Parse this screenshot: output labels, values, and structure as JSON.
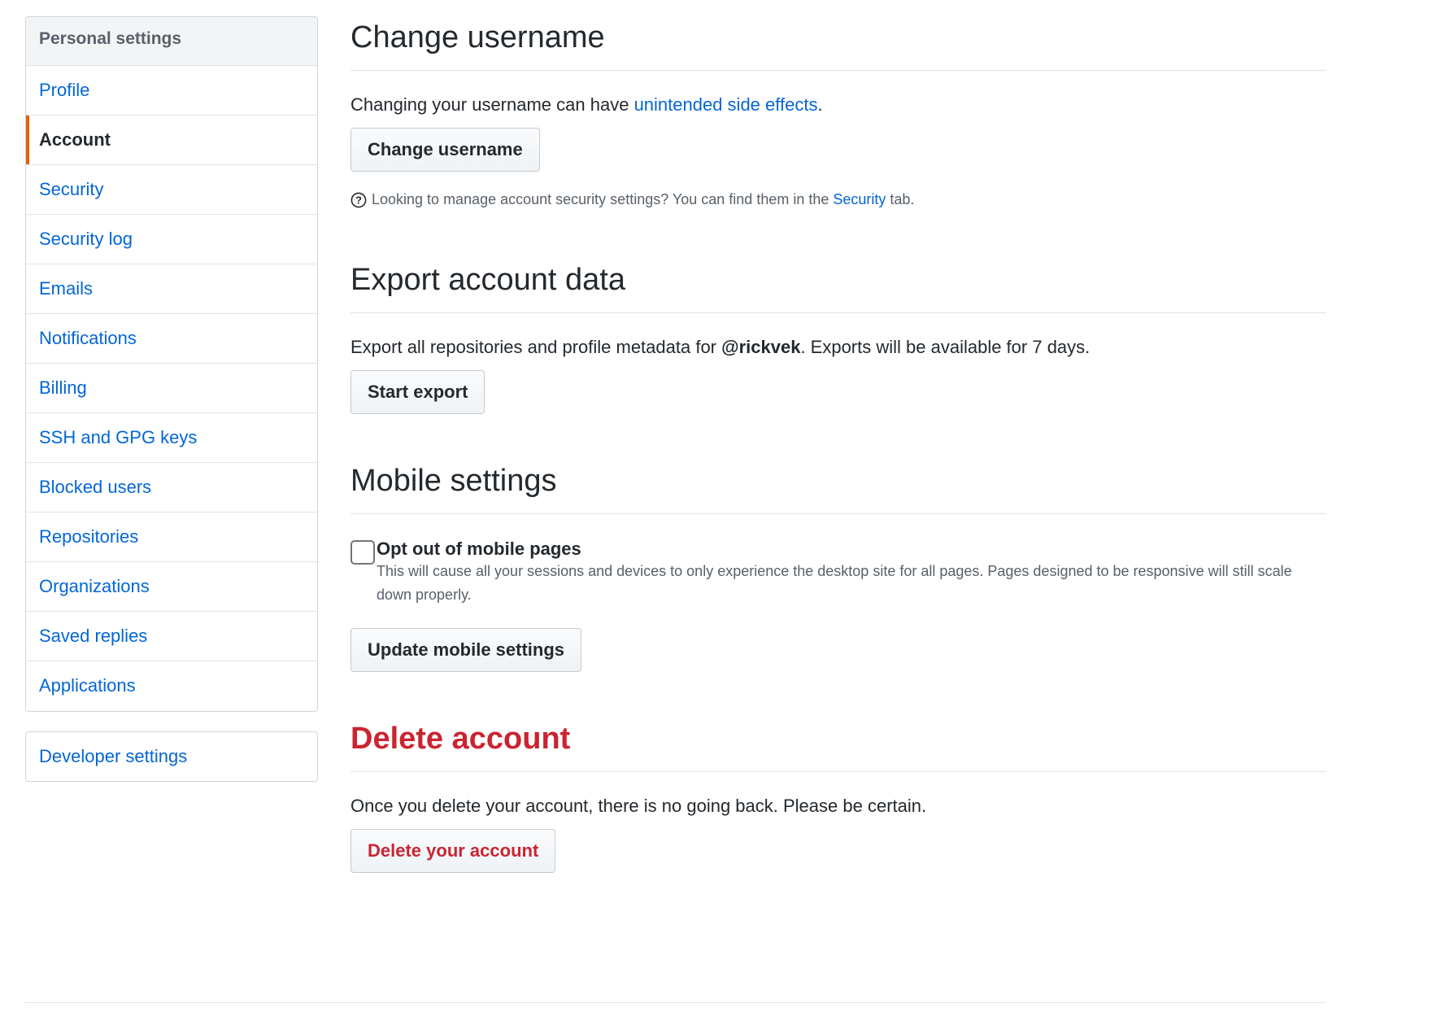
{
  "sidebar": {
    "heading": "Personal settings",
    "items": [
      {
        "label": "Profile"
      },
      {
        "label": "Account",
        "selected": true
      },
      {
        "label": "Security"
      },
      {
        "label": "Security log"
      },
      {
        "label": "Emails"
      },
      {
        "label": "Notifications"
      },
      {
        "label": "Billing"
      },
      {
        "label": "SSH and GPG keys"
      },
      {
        "label": "Blocked users"
      },
      {
        "label": "Repositories"
      },
      {
        "label": "Organizations"
      },
      {
        "label": "Saved replies"
      },
      {
        "label": "Applications"
      }
    ],
    "developer_settings": "Developer settings",
    "accent_color": "#e36209"
  },
  "change_username": {
    "title": "Change username",
    "text_before": "Changing your username can have ",
    "link": "unintended side effects",
    "text_after": ".",
    "button": "Change username",
    "note_before": "Looking to manage account security settings? You can find them in the",
    "note_link": "Security",
    "note_after": "tab."
  },
  "export": {
    "title": "Export account data",
    "text_before": "Export all repositories and profile metadata for ",
    "username": "@rickvek",
    "text_after": ". Exports will be available for 7 days.",
    "button": "Start export"
  },
  "mobile": {
    "title": "Mobile settings",
    "checkbox_label": "Opt out of mobile pages",
    "checkbox_checked": false,
    "description": "This will cause all your sessions and devices to only experience the desktop site for all pages. Pages designed to be responsive will still scale down properly.",
    "button": "Update mobile settings"
  },
  "delete": {
    "title": "Delete account",
    "text": "Once you delete your account, there is no going back. Please be certain.",
    "button": "Delete your account",
    "danger_color": "#cb2431"
  },
  "colors": {
    "link": "#0366d6",
    "text": "#24292e"
  }
}
